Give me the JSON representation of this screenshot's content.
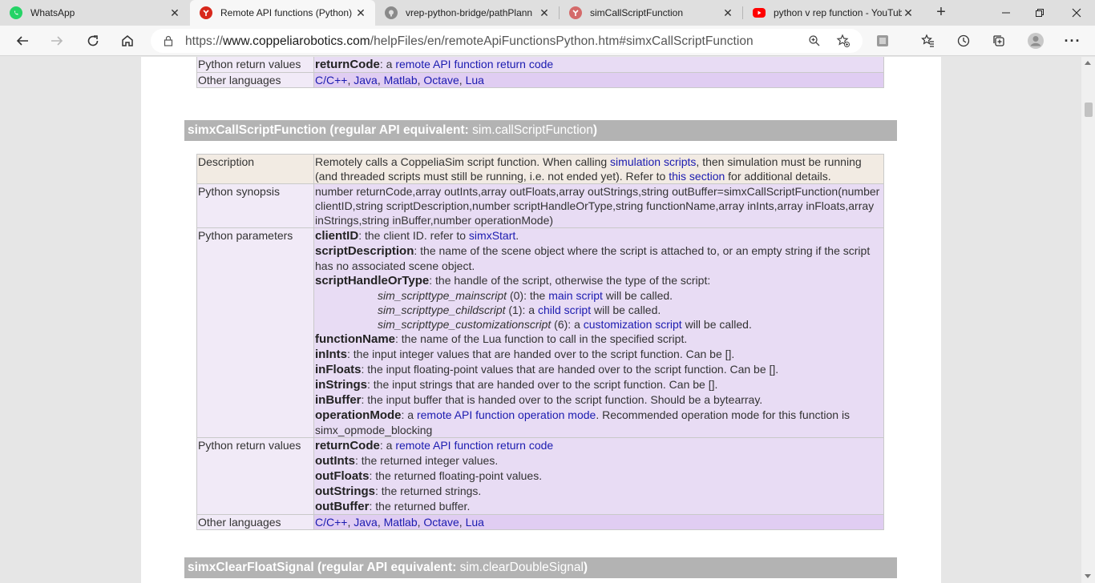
{
  "tabs": [
    {
      "title": "WhatsApp",
      "icon": "whatsapp-icon",
      "active": false
    },
    {
      "title": "Remote API functions (Python)",
      "icon": "coppelia-icon",
      "active": true
    },
    {
      "title": "vrep-python-bridge/pathPlann",
      "icon": "github-icon",
      "active": false
    },
    {
      "title": "simCallScriptFunction",
      "icon": "coppelia-icon",
      "active": false
    },
    {
      "title": "python v rep function - YouTub",
      "icon": "youtube-icon",
      "active": false
    }
  ],
  "address": {
    "prefix": "https://",
    "host": "www.coppeliarobotics.com",
    "path": "/helpFiles/en/remoteApiFunctionsPython.htm#simxCallScriptFunction"
  },
  "colors": {
    "accent_link": "#1b1bb0",
    "section_header": "#b3b3b3",
    "row_label": "#f1eaf7",
    "row_value": "#e8dcf4",
    "row_desc": "#f2ebe3"
  },
  "prev_table": {
    "return_label": "Python return values",
    "return_name": "returnCode",
    "return_sep": ": a ",
    "return_link": "remote API function return code",
    "lang_label": "Other languages",
    "langs": [
      "C/C++",
      "Java",
      "Matlab",
      "Octave",
      "Lua"
    ]
  },
  "section1": {
    "name": "simxCallScriptFunction",
    "equiv_prefix": " (regular API equivalent: ",
    "equiv_link": "sim.callScriptFunction",
    "equiv_suffix": ")"
  },
  "main_table": {
    "desc_label": "Description",
    "desc_1": "Remotely calls a CoppeliaSim script function. When calling ",
    "desc_link1": "simulation scripts",
    "desc_2": ", then simulation must be running (and threaded scripts must still be running, i.e. not ended yet). Refer to ",
    "desc_link2": "this section",
    "desc_3": " for additional details.",
    "synopsis_label": "Python synopsis",
    "synopsis": "number returnCode,array outInts,array outFloats,array outStrings,string outBuffer=simxCallScriptFunction(number clientID,string scriptDescription,number scriptHandleOrType,string functionName,array inInts,array inFloats,array inStrings,string inBuffer,number operationMode)",
    "params_label": "Python parameters",
    "p_clientID": "clientID",
    "p_clientID_text": ": the client ID. refer to ",
    "p_clientID_link": "simxStart",
    "p_clientID_end": ".",
    "p_scriptDescription": "scriptDescription",
    "p_scriptDescription_text": ": the name of the scene object where the script is attached to, or an empty string if the script has no associated scene object.",
    "p_scriptHandleOrType": "scriptHandleOrType",
    "p_scriptHandleOrType_text": ": the handle of the script, otherwise the type of the script:",
    "type_main": "sim_scripttype_mainscript",
    "type_main_text": " (0): the ",
    "type_main_link": "main script",
    "type_main_end": " will be called.",
    "type_child": "sim_scripttype_childscript",
    "type_child_text": " (1): a ",
    "type_child_link": "child script",
    "type_child_end": " will be called.",
    "type_custom": "sim_scripttype_customizationscript",
    "type_custom_text": " (6): a ",
    "type_custom_link": "customization script",
    "type_custom_end": " will be called.",
    "p_functionName": "functionName",
    "p_functionName_text": ": the name of the Lua function to call in the specified script.",
    "p_inInts": "inInts",
    "p_inInts_text": ": the input integer values that are handed over to the script function. Can be [].",
    "p_inFloats": "inFloats",
    "p_inFloats_text": ": the input floating-point values that are handed over to the script function. Can be [].",
    "p_inStrings": "inStrings",
    "p_inStrings_text": ": the input strings that are handed over to the script function. Can be [].",
    "p_inBuffer": "inBuffer",
    "p_inBuffer_text": ": the input buffer that is handed over to the script function. Should be a bytearray.",
    "p_operationMode": "operationMode",
    "p_operationMode_text": ": a ",
    "p_operationMode_link": "remote API function operation mode",
    "p_operationMode_end": ". Recommended operation mode for this function is simx_opmode_blocking",
    "return_label": "Python return values",
    "r_returnCode": "returnCode",
    "r_returnCode_text": ": a ",
    "r_returnCode_link": "remote API function return code",
    "r_outInts": "outInts",
    "r_outInts_text": ": the returned integer values.",
    "r_outFloats": "outFloats",
    "r_outFloats_text": ": the returned floating-point values.",
    "r_outStrings": "outStrings",
    "r_outStrings_text": ": the returned strings.",
    "r_outBuffer": "outBuffer",
    "r_outBuffer_text": ": the returned buffer.",
    "lang_label": "Other languages",
    "langs": [
      "C/C++",
      "Java",
      "Matlab",
      "Octave",
      "Lua"
    ]
  },
  "section2": {
    "name": "simxClearFloatSignal",
    "equiv_prefix": " (regular API equivalent: ",
    "equiv_link": "sim.clearDoubleSignal",
    "equiv_suffix": ")"
  }
}
